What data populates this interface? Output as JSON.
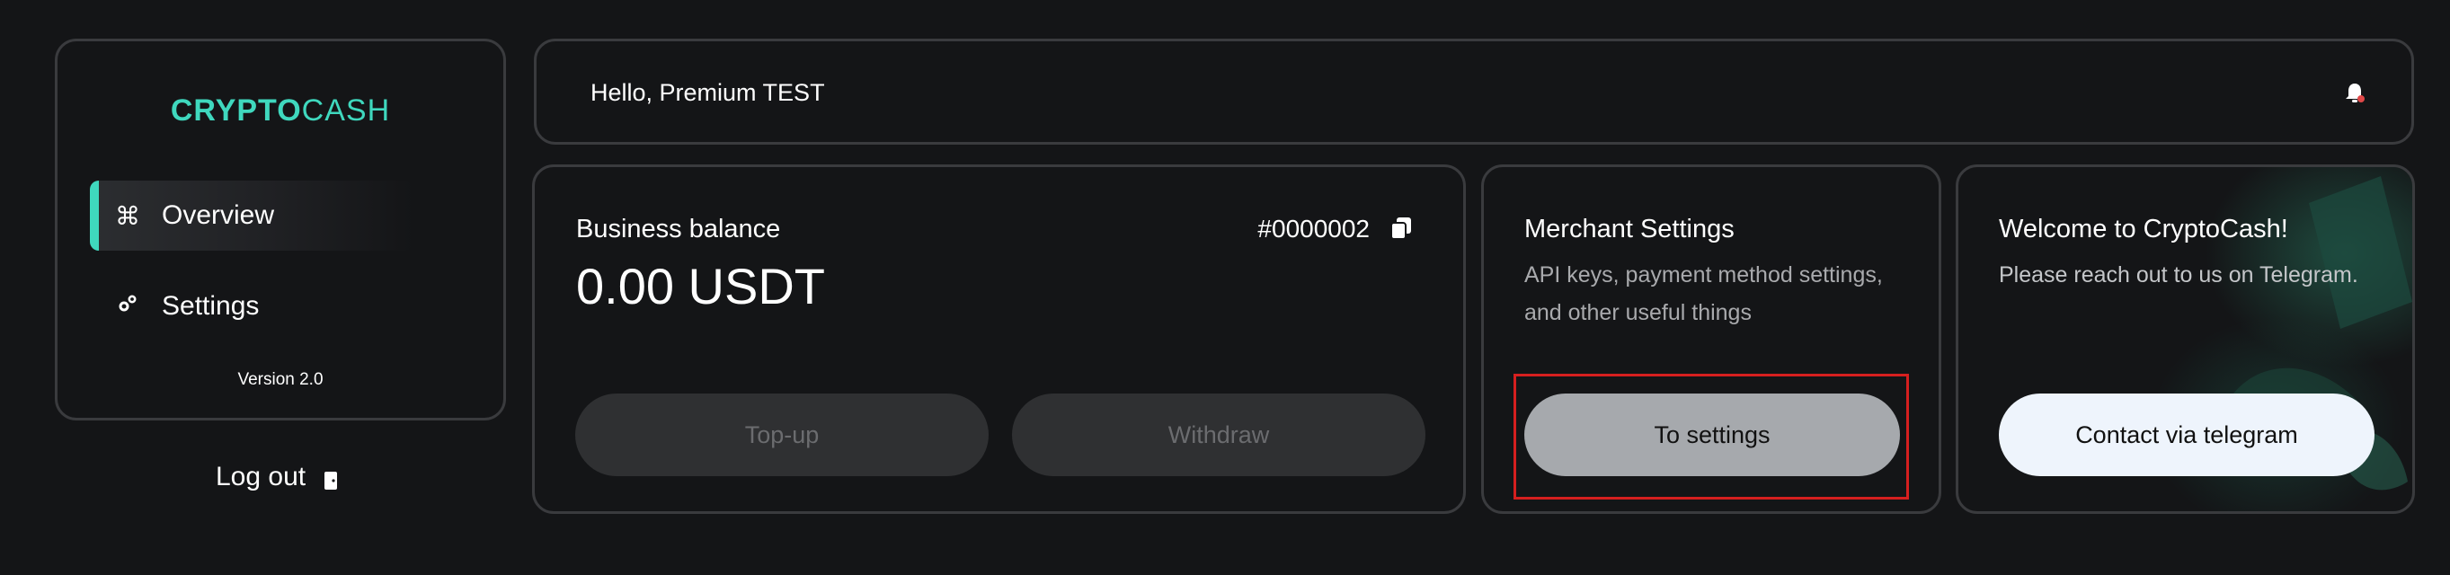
{
  "sidebar": {
    "logo_bold": "CRYPTO",
    "logo_light": "CASH",
    "items": [
      {
        "label": "Overview",
        "icon": "command-icon",
        "active": true
      },
      {
        "label": "Settings",
        "icon": "gears-icon",
        "active": false
      }
    ],
    "version": "Version 2.0",
    "logout_label": "Log out"
  },
  "header": {
    "greeting": "Hello, Premium TEST",
    "bell_icon": "bell-icon"
  },
  "balance_card": {
    "title": "Business balance",
    "amount": "0.00 USDT",
    "account_id": "#0000002",
    "topup_label": "Top-up",
    "withdraw_label": "Withdraw"
  },
  "merchant_card": {
    "title": "Merchant Settings",
    "desc_line1": "API keys, payment method settings,",
    "desc_line2": "and other useful things",
    "button_label": "To settings"
  },
  "welcome_card": {
    "title": "Welcome to CryptoCash!",
    "desc": "Please reach out to us on Telegram.",
    "button_label": "Contact via telegram"
  },
  "colors": {
    "accent": "#3fd8be",
    "background": "#141517",
    "border": "#3a3b3e",
    "highlight": "#d61f1f"
  }
}
